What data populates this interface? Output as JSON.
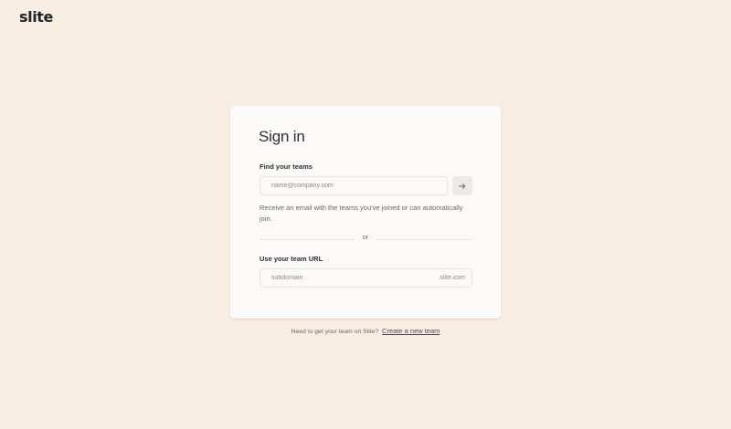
{
  "app": {
    "logo_text": "slite"
  },
  "signin": {
    "title": "Sign in",
    "find_teams_label": "Find your teams",
    "email_placeholder": "name@company.com",
    "email_value": "",
    "submit_icon": "arrow-right-icon",
    "helper_text": "Receive an email with the teams you've joined or can automatically join.",
    "divider_text": "or",
    "team_url_label": "Use your team URL",
    "subdomain_placeholder": "subdomain",
    "subdomain_value": "",
    "domain_suffix": ".slite.com"
  },
  "footer": {
    "prompt_text": "Need to get your team on Slite?",
    "create_link_text": "Create a new team"
  },
  "colors": {
    "background": "#f8ede3",
    "card": "#fbfaf9",
    "text": "#2f2f33",
    "muted": "#6a6866",
    "border": "#e6e2de",
    "button": "#ece9e6"
  }
}
